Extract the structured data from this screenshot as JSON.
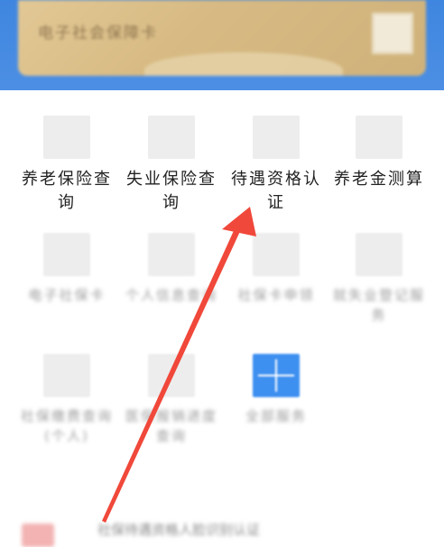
{
  "card": {
    "title": "电子社会保障卡"
  },
  "services": {
    "row1": [
      {
        "label": "养老保险查询",
        "icon": "pension-query-icon"
      },
      {
        "label": "失业保险查询",
        "icon": "unemployment-query-icon"
      },
      {
        "label": "待遇资格认证",
        "icon": "benefit-qualification-icon"
      },
      {
        "label": "养老金测算",
        "icon": "pension-calculator-icon"
      }
    ],
    "row2": [
      {
        "label": "电子社保卡",
        "icon": "e-social-card-icon"
      },
      {
        "label": "个人信息查询",
        "icon": "personal-info-icon"
      },
      {
        "label": "社保卡申领",
        "icon": "card-apply-icon"
      },
      {
        "label": "就失业登记服务",
        "icon": "employment-registration-icon"
      }
    ],
    "row3": [
      {
        "label": "社保缴费查询(个人)",
        "icon": "payment-query-icon"
      },
      {
        "label": "医保报销进度查询",
        "icon": "medical-reimbursement-icon"
      },
      {
        "label": "全部服务",
        "icon": "all-services-grid-icon"
      }
    ]
  },
  "banner": {
    "text": "社保待遇资格人脸识别认证"
  },
  "colors": {
    "header_blue": "#3f86e0",
    "card_gold": "#d8bb84",
    "arrow_red": "#f0483a",
    "grid_icon_blue": "#3d8ff0"
  }
}
